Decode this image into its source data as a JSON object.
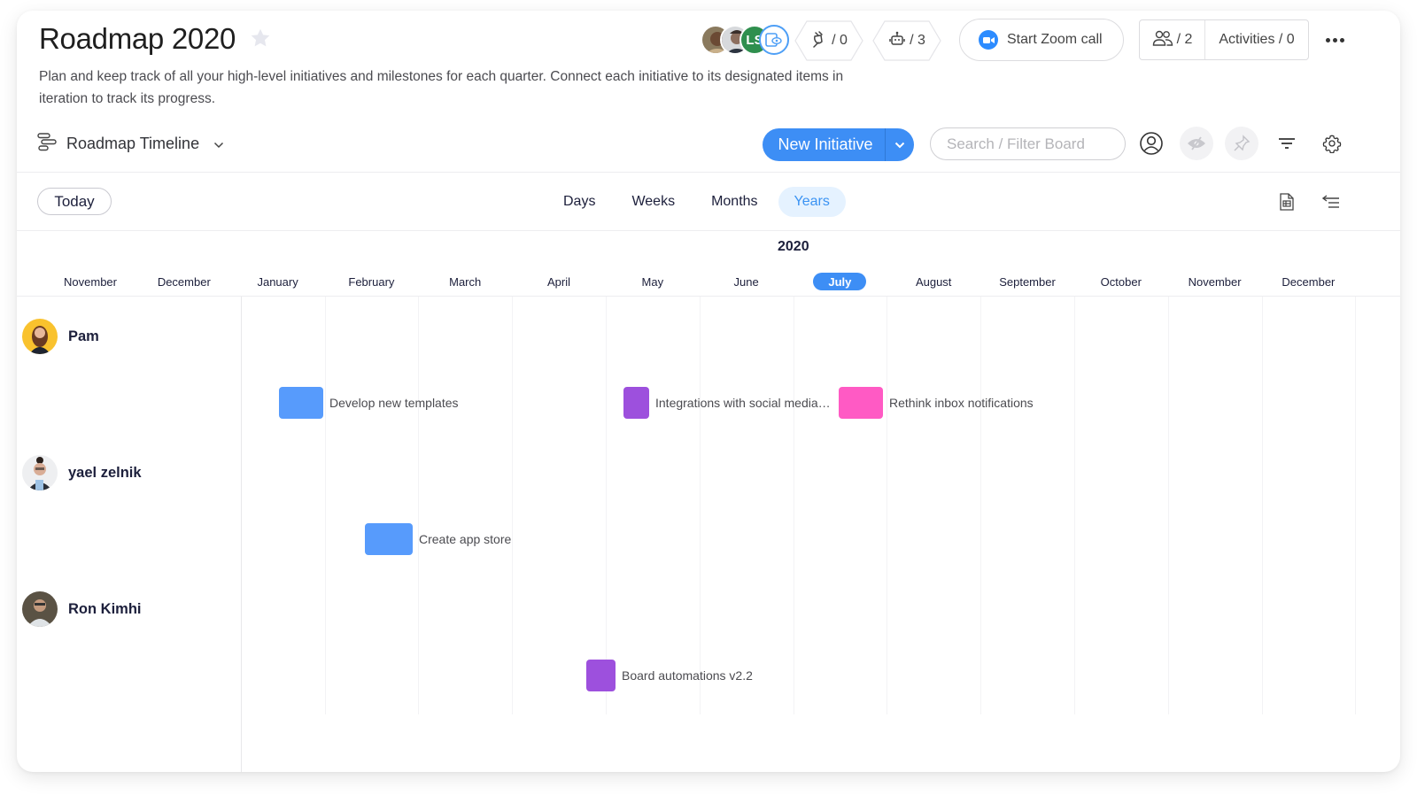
{
  "header": {
    "title": "Roadmap 2020",
    "description": "Plan and keep track of all your high-level initiatives and milestones for each quarter. Connect each initiative to its designated items in iteration to track its progress.",
    "subscribers": [
      {
        "kind": "photo",
        "name": "subscriber-1"
      },
      {
        "kind": "photo",
        "name": "subscriber-2"
      },
      {
        "kind": "initials",
        "initials": "LS"
      },
      {
        "kind": "guest",
        "icon": "guest-view-icon"
      }
    ],
    "integrations_count": "/ 0",
    "automations_count": "/ 3",
    "zoom_label": "Start Zoom call",
    "members_count": "/ 2",
    "activities_label": "Activities / 0"
  },
  "toolbar": {
    "view_name": "Roadmap Timeline",
    "new_button_label": "New Initiative",
    "search_placeholder": "Search / Filter Board",
    "search_value": ""
  },
  "timeline": {
    "today_label": "Today",
    "scales": [
      {
        "label": "Days",
        "active": false
      },
      {
        "label": "Weeks",
        "active": false
      },
      {
        "label": "Months",
        "active": false
      },
      {
        "label": "Years",
        "active": true
      }
    ],
    "year": "2020",
    "months": [
      "November",
      "December",
      "January",
      "February",
      "March",
      "April",
      "May",
      "June",
      "July",
      "August",
      "September",
      "October",
      "November",
      "December"
    ],
    "current_month_index": 8,
    "groups": [
      {
        "person": "Pam",
        "items": [
          {
            "label": "Develop new templates",
            "color": "#579bfc"
          },
          {
            "label": "Integrations with social media…",
            "color": "#9d50dd"
          },
          {
            "label": "Rethink inbox notifications",
            "color": "#ff5ac4"
          }
        ]
      },
      {
        "person": "yael zelnik",
        "items": [
          {
            "label": "Create app store",
            "color": "#579bfc"
          }
        ]
      },
      {
        "person": "Ron Kimhi",
        "items": [
          {
            "label": "Board automations v2.2",
            "color": "#9d50dd"
          }
        ]
      }
    ]
  },
  "colors": {
    "accent": "#3d8ef5",
    "accent_light": "#e5f2ff",
    "zoom_blue": "#2d8cff",
    "initials_avatar": "#2f8f4e"
  }
}
